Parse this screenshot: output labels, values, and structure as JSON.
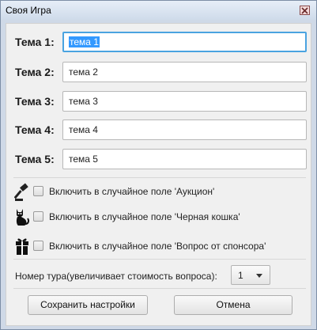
{
  "window": {
    "title": "Своя Игра"
  },
  "topics": [
    {
      "label": "Тема 1:",
      "value": "тема 1"
    },
    {
      "label": "Тема 2:",
      "value": "тема 2"
    },
    {
      "label": "Тема 3:",
      "value": "тема 3"
    },
    {
      "label": "Тема 4:",
      "value": "тема 4"
    },
    {
      "label": "Тема 5:",
      "value": "тема 5"
    }
  ],
  "options": [
    {
      "icon": "gavel-icon",
      "label": "Включить в случайное поле 'Аукцион'",
      "checked": false
    },
    {
      "icon": "black-cat-icon",
      "label": "Включить в случайное поле 'Черная кошка'",
      "checked": false
    },
    {
      "icon": "gift-icon",
      "label": "Включить в случайное поле 'Вопрос от спонсора'",
      "checked": false
    }
  ],
  "tour": {
    "label": "Номер тура(увеличивает стоимость вопроса):",
    "value": "1"
  },
  "buttons": {
    "save": "Сохранить настройки",
    "cancel": "Отмена"
  }
}
